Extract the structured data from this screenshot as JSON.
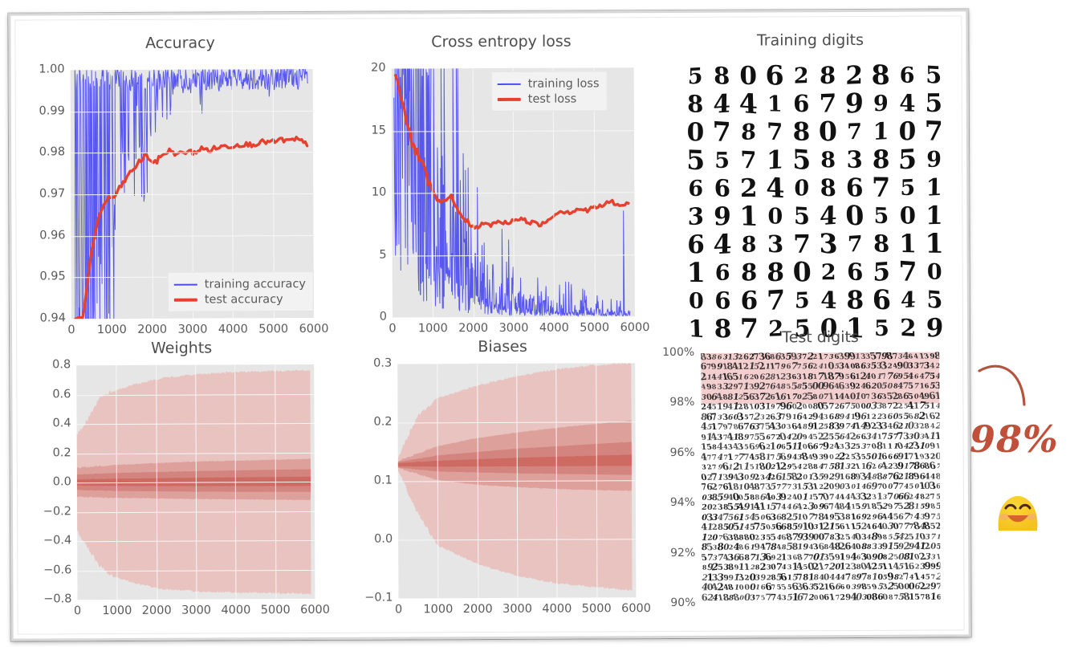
{
  "chart_data": [
    {
      "type": "line",
      "title": "Accuracy",
      "xlabel": "",
      "ylabel": "",
      "xlim": [
        0,
        6100
      ],
      "ylim": [
        0.94,
        1.0
      ],
      "xticks": [
        "0",
        "1000",
        "2000",
        "3000",
        "4000",
        "5000",
        "6000"
      ],
      "yticks": [
        "0.94",
        "0.95",
        "0.96",
        "0.97",
        "0.98",
        "0.99",
        "1.00"
      ],
      "grid": true,
      "legend_position": "lower right",
      "series": [
        {
          "name": "training accuracy",
          "color": "#4c4cf0",
          "style": "thin-noisy",
          "x": [
            100,
            300,
            500,
            700,
            900,
            1100,
            1300,
            1500,
            1700,
            1900,
            2100,
            2300,
            2500,
            2700,
            2900,
            3100,
            3300,
            3500,
            3700,
            3900,
            4100,
            4300,
            4500,
            4700,
            4900,
            5100,
            5300,
            5500,
            5700,
            5900
          ],
          "values": [
            0.94,
            0.952,
            0.946,
            0.968,
            0.955,
            0.972,
            0.99,
            0.98,
            0.995,
            0.985,
            0.999,
            1.0,
            0.996,
            1.0,
            0.998,
            1.0,
            0.993,
            1.0,
            1.0,
            0.998,
            1.0,
            1.0,
            0.997,
            1.0,
            1.0,
            0.999,
            1.0,
            1.0,
            1.0,
            0.999
          ]
        },
        {
          "name": "test accuracy",
          "color": "#e6402e",
          "style": "thick-smooth",
          "x": [
            100,
            300,
            500,
            700,
            900,
            1100,
            1300,
            1500,
            1700,
            1900,
            2100,
            2300,
            2500,
            2700,
            2900,
            3100,
            3300,
            3500,
            3700,
            3900,
            4100,
            4300,
            4500,
            4700,
            4900,
            5100,
            5300,
            5500,
            5700,
            5900
          ],
          "values": [
            0.9401,
            0.9405,
            0.9555,
            0.9648,
            0.9688,
            0.9694,
            0.9725,
            0.9752,
            0.9775,
            0.9795,
            0.9772,
            0.9795,
            0.9805,
            0.9795,
            0.9802,
            0.98,
            0.9809,
            0.9805,
            0.9812,
            0.9815,
            0.9816,
            0.982,
            0.9818,
            0.9822,
            0.9825,
            0.9824,
            0.983,
            0.9826,
            0.9831,
            0.982
          ]
        }
      ]
    },
    {
      "type": "line",
      "title": "Cross entropy loss",
      "xlabel": "",
      "ylabel": "",
      "xlim": [
        0,
        6100
      ],
      "ylim": [
        0,
        20
      ],
      "xticks": [
        "0",
        "1000",
        "2000",
        "3000",
        "4000",
        "5000",
        "6000"
      ],
      "yticks": [
        "0",
        "5",
        "10",
        "15",
        "20"
      ],
      "grid": true,
      "legend_position": "upper right",
      "series": [
        {
          "name": "training loss",
          "color": "#4c4cf0",
          "style": "thin-noisy",
          "x": [
            100,
            300,
            500,
            700,
            900,
            1100,
            1300,
            1500,
            1700,
            1900,
            2100,
            2300,
            2500,
            2700,
            2900,
            3100,
            3300,
            3500,
            3700,
            3900,
            4100,
            4300,
            4500,
            4700,
            4900,
            5100,
            5300,
            5500,
            5700,
            5900
          ],
          "values": [
            20.0,
            18.5,
            16.0,
            14.0,
            12.0,
            9.5,
            8.0,
            6.0,
            5.0,
            4.0,
            3.0,
            2.5,
            2.0,
            1.8,
            1.5,
            1.4,
            1.2,
            1.1,
            1.0,
            0.9,
            0.8,
            0.8,
            0.7,
            0.6,
            0.5,
            0.5,
            0.4,
            0.4,
            0.3,
            0.3
          ]
        },
        {
          "name": "test loss",
          "color": "#e6402e",
          "style": "thick-smooth",
          "x": [
            100,
            300,
            500,
            700,
            900,
            1100,
            1300,
            1500,
            1700,
            1900,
            2100,
            2300,
            2500,
            2700,
            2900,
            3100,
            3300,
            3500,
            3700,
            3900,
            4100,
            4300,
            4500,
            4700,
            4900,
            5100,
            5300,
            5500,
            5700,
            5900
          ],
          "values": [
            19.8,
            17.0,
            14.0,
            12.8,
            11.0,
            9.4,
            9.2,
            9.8,
            8.2,
            7.7,
            7.1,
            7.5,
            7.4,
            7.7,
            7.5,
            7.9,
            7.8,
            7.6,
            7.4,
            7.7,
            8.3,
            8.5,
            8.4,
            8.7,
            8.5,
            8.8,
            8.9,
            9.3,
            8.9,
            9.0
          ]
        }
      ]
    },
    {
      "type": "area",
      "title": "Weights",
      "xlabel": "",
      "ylabel": "",
      "xlim": [
        0,
        6100
      ],
      "ylim": [
        -0.8,
        0.8
      ],
      "xticks": [
        "0",
        "1000",
        "2000",
        "3000",
        "4000",
        "5000",
        "6000"
      ],
      "yticks": [
        "-0.8",
        "-0.6",
        "-0.4",
        "-0.2",
        "0.0",
        "0.2",
        "0.4",
        "0.6",
        "0.8"
      ],
      "grid": true,
      "legend_position": "none",
      "description": "Percentile bands of weight distribution over training steps",
      "series": [
        {
          "name": "min-max band",
          "color": "#e9c3c0",
          "x": [
            0,
            300,
            600,
            900,
            1500,
            2200,
            3000,
            4000,
            5000,
            6000
          ],
          "upper": [
            0.33,
            0.44,
            0.58,
            0.62,
            0.67,
            0.71,
            0.735,
            0.75,
            0.755,
            0.76
          ],
          "lower": [
            -0.33,
            -0.46,
            -0.58,
            -0.64,
            -0.69,
            -0.73,
            -0.745,
            -0.755,
            -0.76,
            -0.765
          ]
        },
        {
          "name": "p25-p75 band",
          "color": "#dda09b",
          "x": [
            0,
            1000,
            3000,
            6000
          ],
          "upper": [
            0.1,
            0.12,
            0.14,
            0.155
          ],
          "lower": [
            -0.095,
            -0.105,
            -0.115,
            -0.125
          ]
        },
        {
          "name": "p45-p55 band",
          "color": "#d4847e",
          "x": [
            0,
            1000,
            3000,
            6000
          ],
          "upper": [
            0.055,
            0.065,
            0.075,
            0.085
          ],
          "lower": [
            -0.05,
            -0.058,
            -0.065,
            -0.07
          ]
        },
        {
          "name": "median band",
          "color": "#cd6a61",
          "x": [
            0,
            1000,
            3000,
            6000
          ],
          "upper": [
            0.022,
            0.026,
            0.03,
            0.034
          ],
          "lower": [
            -0.02,
            -0.024,
            -0.027,
            -0.03
          ]
        }
      ]
    },
    {
      "type": "area",
      "title": "Biases",
      "xlabel": "",
      "ylabel": "",
      "xlim": [
        0,
        6100
      ],
      "ylim": [
        -0.14,
        0.3
      ],
      "xticks": [
        "0",
        "1000",
        "2000",
        "3000",
        "4000",
        "5000",
        "6000"
      ],
      "yticks": [
        "-0.1",
        "0.0",
        "0.1",
        "0.2",
        "0.3"
      ],
      "grid": true,
      "legend_position": "none",
      "description": "Percentile bands of bias distribution over training steps",
      "series": [
        {
          "name": "min-max band",
          "color": "#e9c3c0",
          "x": [
            0,
            500,
            1000,
            2000,
            3000,
            4000,
            5000,
            6000
          ],
          "upper": [
            0.125,
            0.2,
            0.235,
            0.258,
            0.275,
            0.288,
            0.296,
            0.3
          ],
          "lower": [
            0.1,
            0.02,
            -0.04,
            -0.075,
            -0.098,
            -0.112,
            -0.12,
            -0.127
          ]
        },
        {
          "name": "p25-p75 band",
          "color": "#dda09b",
          "x": [
            0,
            1000,
            2000,
            3000,
            4500,
            6000
          ],
          "upper": [
            0.118,
            0.145,
            0.16,
            0.17,
            0.182,
            0.192
          ],
          "lower": [
            0.105,
            0.082,
            0.073,
            0.068,
            0.063,
            0.06
          ]
        },
        {
          "name": "p45-p55 band",
          "color": "#d4847e",
          "x": [
            0,
            1000,
            3000,
            6000
          ],
          "upper": [
            0.116,
            0.128,
            0.14,
            0.152
          ],
          "lower": [
            0.106,
            0.098,
            0.094,
            0.09
          ]
        },
        {
          "name": "median band",
          "color": "#cd6a61",
          "x": [
            0,
            1000,
            3000,
            6000
          ],
          "upper": [
            0.114,
            0.118,
            0.123,
            0.128
          ],
          "lower": [
            0.108,
            0.107,
            0.107,
            0.107
          ]
        }
      ]
    },
    {
      "type": "heatmap",
      "title": "Test digits",
      "xlabel": "",
      "ylabel": "",
      "ylim": [
        90,
        100
      ],
      "yticks": [
        "90%",
        "92%",
        "94%",
        "96%",
        "98%",
        "100%"
      ],
      "grid": false,
      "legend_position": "none",
      "description": "Grid of all test digits; misclassified ones highlighted on pink background band spanning roughly 98%-100%",
      "highlight_band": {
        "from": "98%",
        "to": "100%",
        "color": "#f3cfcf"
      }
    }
  ],
  "panels": {
    "accuracy": {
      "title": "Accuracy",
      "yticks": [
        "1.00",
        "0.99",
        "0.98",
        "0.97",
        "0.96",
        "0.95",
        "0.94"
      ],
      "xticks": [
        "0",
        "1000",
        "2000",
        "3000",
        "4000",
        "5000",
        "6000"
      ],
      "legend": [
        {
          "label": "training accuracy",
          "style": "thin"
        },
        {
          "label": "test accuracy",
          "style": "thick"
        }
      ]
    },
    "loss": {
      "title": "Cross entropy loss",
      "yticks": [
        "20",
        "15",
        "10",
        "5",
        "0"
      ],
      "xticks": [
        "0",
        "1000",
        "2000",
        "3000",
        "4000",
        "5000",
        "6000"
      ],
      "legend": [
        {
          "label": "training loss",
          "style": "thin"
        },
        {
          "label": "test loss",
          "style": "thick"
        }
      ]
    },
    "weights": {
      "title": "Weights",
      "yticks": [
        "0.8",
        "0.6",
        "0.4",
        "0.2",
        "0.0",
        "−0.2",
        "−0.4",
        "−0.6",
        "−0.8"
      ],
      "xticks": [
        "0",
        "1000",
        "2000",
        "3000",
        "4000",
        "5000",
        "6000"
      ]
    },
    "biases": {
      "title": "Biases",
      "yticks": [
        "0.3",
        "0.2",
        "0.1",
        "0.0",
        "−0.1"
      ],
      "xticks": [
        "0",
        "1000",
        "2000",
        "3000",
        "4000",
        "5000",
        "6000"
      ]
    },
    "training_digits": {
      "title": "Training digits",
      "rows": [
        "5 8 0 6 2 8 2 8 6 5",
        "8 4 4 1 6 7 9 9 4 5",
        "0 7 8 7 8 0 7 1 0 7",
        "5 5 7 1 5 8 3 8 5 9",
        "6 6 2 4 0 8 6 7 5 1",
        "3 9 1 0 5 4 0 5 0 1",
        "6 4 8 3 7 3 7 8 1 1",
        "1 6 8 8 0 2 6 5 7 0",
        "0 6 6 7 5 4 8 6 4 5",
        "1 8 7 2 5 0 1 5 2 9"
      ]
    },
    "test_digits": {
      "title": "Test digits",
      "yticks": [
        "100%",
        "98%",
        "96%",
        "94%",
        "92%",
        "90%"
      ]
    }
  },
  "annotation": {
    "percent_text": "98%",
    "percent_color": "#c0503a",
    "emoji_name": "grinning-smiling-eyes-emoji"
  },
  "colors": {
    "training_line": "#4c4cf0",
    "test_line": "#e6402e",
    "plot_background": "#e6e6e6",
    "grid": "#f7f7f7",
    "band_outer": "#e9c3c0",
    "band_mid": "#dda09b",
    "band_inner": "#d4847e",
    "band_core": "#cd6a61",
    "highlight_pink": "#f3cfcf",
    "text": "#5a5a5a"
  }
}
